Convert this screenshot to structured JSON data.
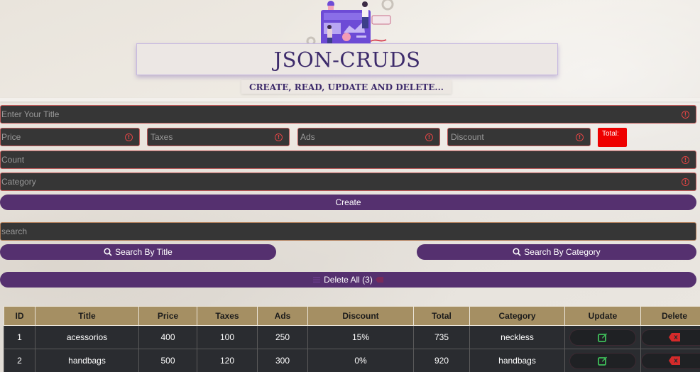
{
  "header": {
    "title": "JSON-CRUDS",
    "subtitle": "CREATE, READ, UPDATE AND DELETE..."
  },
  "form": {
    "title_placeholder": "Enter Your Title",
    "price_placeholder": "Price",
    "taxes_placeholder": "Taxes",
    "ads_placeholder": "Ads",
    "discount_placeholder": "Discount",
    "total_label": "Total:",
    "count_placeholder": "Count",
    "category_placeholder": "Category",
    "create_label": "Create",
    "warning_glyph": "!"
  },
  "search": {
    "placeholder": "search",
    "by_title_label": "Search By Title",
    "by_category_label": "Search By Category"
  },
  "delete_all_label": "Delete All (3)",
  "colors": {
    "accent": "#55306f",
    "total_badge": "#ee0000",
    "header_row": "#a58f63",
    "edit_icon": "#3fbf5a",
    "delete_icon": "#d42a2a"
  },
  "table": {
    "columns": [
      "ID",
      "Title",
      "Price",
      "Taxes",
      "Ads",
      "Discount",
      "Total",
      "Category",
      "Update",
      "Delete"
    ],
    "rows": [
      {
        "id": "1",
        "title": "acessorios",
        "price": "400",
        "taxes": "100",
        "ads": "250",
        "discount": "15%",
        "total": "735",
        "category": "neckless",
        "update_icon": "edit-icon",
        "delete_icon": "backspace-icon"
      },
      {
        "id": "2",
        "title": "handbags",
        "price": "500",
        "taxes": "120",
        "ads": "300",
        "discount": "0%",
        "total": "920",
        "category": "handbags",
        "update_icon": "edit-icon",
        "delete_icon": "backspace-icon"
      }
    ]
  }
}
